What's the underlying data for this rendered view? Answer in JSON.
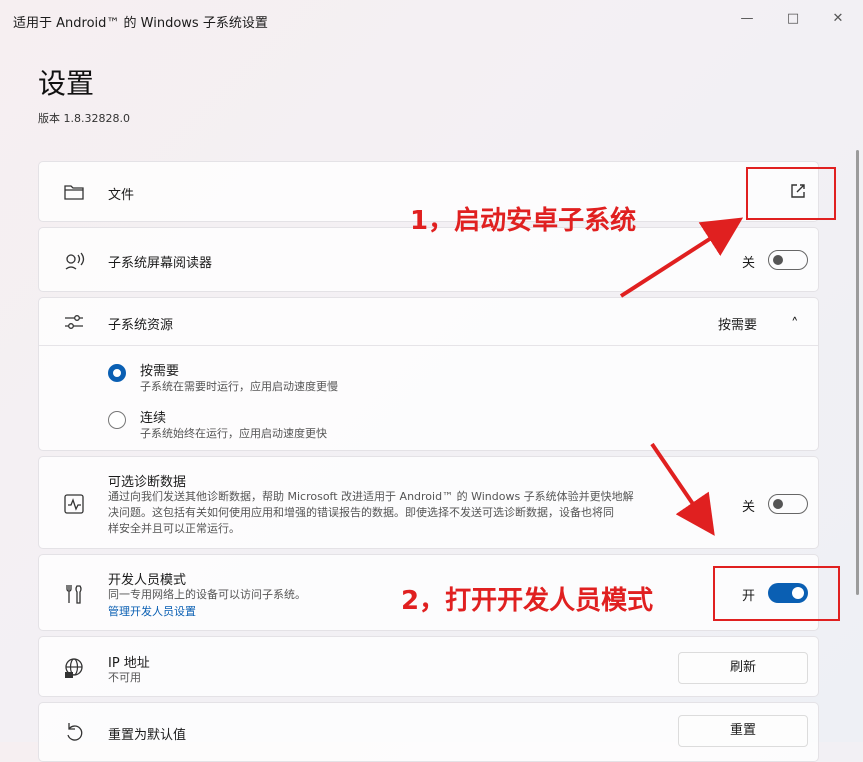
{
  "window": {
    "title": "适用于 Android™ 的 Windows 子系统设置",
    "minimize_glyph": "—",
    "maximize_glyph": "□",
    "close_glyph": "✕"
  },
  "page": {
    "title": "设置",
    "version": "版本 1.8.32828.0"
  },
  "files": {
    "label": "文件",
    "icon": "folder-icon",
    "action_icon": "open-external-icon"
  },
  "screen_reader": {
    "label": "子系统屏幕阅读器",
    "icon": "screen-reader-icon",
    "state_label": "关",
    "enabled": false
  },
  "resources": {
    "label": "子系统资源",
    "icon": "sliders-icon",
    "selected": "按需要",
    "chevron": "˄",
    "options": [
      {
        "label": "按需要",
        "desc": "子系统在需要时运行，应用启动速度更慢",
        "selected": true
      },
      {
        "label": "连续",
        "desc": "子系统始终在运行，应用启动速度更快",
        "selected": false
      }
    ]
  },
  "diagnostics": {
    "label": "可选诊断数据",
    "icon": "diagnostics-icon",
    "desc_lines": [
      "通过向我们发送其他诊断数据，帮助 Microsoft 改进适用于 Android™ 的 Windows 子系统体验并更快地解",
      "决问题。这包括有关如何使用应用和增强的错误报告的数据。即使选择不发送可选诊断数据，设备也将同",
      "样安全并且可以正常运行。"
    ],
    "state_label": "关",
    "enabled": false
  },
  "developer": {
    "label": "开发人员模式",
    "icon": "developer-tools-icon",
    "desc": "同一专用网络上的设备可以访问子系统。",
    "link": "管理开发人员设置",
    "state_label": "开",
    "enabled": true
  },
  "ip": {
    "label": "IP 地址",
    "icon": "globe-icon",
    "value": "不可用",
    "button": "刷新"
  },
  "reset": {
    "label": "重置为默认值",
    "icon": "reset-icon",
    "button": "重置"
  },
  "annotations": {
    "step1": "1，启动安卓子系统",
    "step2": "2，打开开发人员模式",
    "color": "#e02020"
  },
  "colors": {
    "accent": "#0a5fb3",
    "link": "#0a5fb3"
  }
}
